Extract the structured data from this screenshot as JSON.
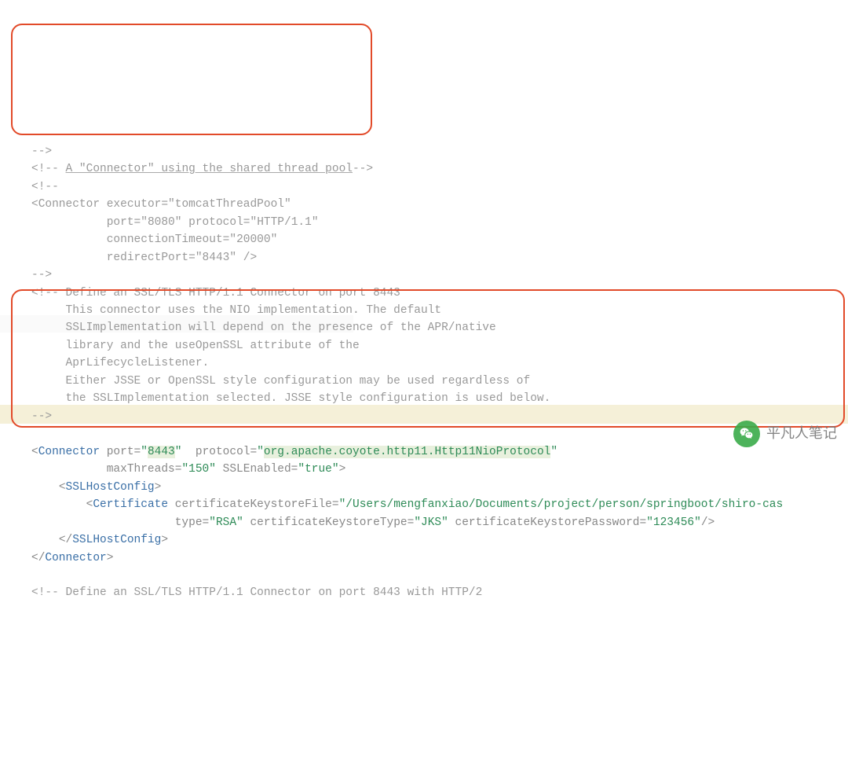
{
  "code": {
    "l1": "-->",
    "l2_open": "<!-- ",
    "l2_text": "A \"Connector\" using the shared thread pool",
    "l2_close": "-->",
    "l3": "<!--",
    "l4_tag": "Connector",
    "l4_attr1_name": "executor",
    "l4_attr1_val": "tomcatThreadPool",
    "l5_attr1_name": "port",
    "l5_attr1_val": "8080",
    "l5_attr2_name": "protocol",
    "l5_attr2_val": "HTTP/1.1",
    "l6_attr1_name": "connectionTimeout",
    "l6_attr1_val": "20000",
    "l7_attr1_name": "redirectPort",
    "l7_attr1_val": "8443",
    "l8": "-->",
    "c1": "<!-- Define an SSL/TLS HTTP/1.1 Connector on port 8443",
    "c2": "     This connector uses the NIO implementation. The default",
    "c3": "     SSLImplementation will depend on the presence of the APR/native",
    "c4": "     library and the useOpenSSL attribute of the",
    "c5": "     AprLifecycleListener.",
    "c6": "     Either JSSE or OpenSSL style configuration may be used regardless of",
    "c7": "     the SSLImplementation selected. JSSE style configuration is used below.",
    "c8": "-->",
    "con_tag": "Connector",
    "con_port_name": "port",
    "con_port_val": "8443",
    "con_proto_name": "protocol",
    "con_proto_val": "org.apache.coyote.http11.Http11NioProtocol",
    "con_max_name": "maxThreads",
    "con_max_val": "150",
    "con_ssl_name": "SSLEnabled",
    "con_ssl_val": "true",
    "sslhost_tag": "SSLHostConfig",
    "cert_tag": "Certificate",
    "cert_ksf_name": "certificateKeystoreFile",
    "cert_ksf_val": "/Users/mengfanxiao/Documents/project/person/springboot/shiro-cas",
    "cert_type_name": "type",
    "cert_type_val": "RSA",
    "cert_kst_name": "certificateKeystoreType",
    "cert_kst_val": "JKS",
    "cert_ksp_name": "certificateKeystorePassword",
    "cert_ksp_val": "123456",
    "last_comment": "<!-- Define an SSL/TLS HTTP/1.1 Connector on port 8443 with HTTP/2"
  },
  "watermark_text": "平凡人笔记"
}
